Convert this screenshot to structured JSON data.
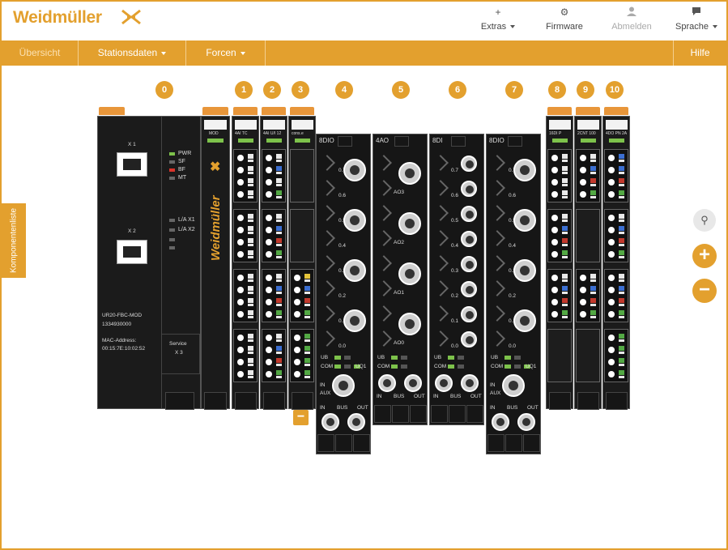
{
  "brand": {
    "name": "Weidmüller"
  },
  "toolbar": {
    "extras": "Extras",
    "firmware": "Firmware",
    "logout": "Abmelden",
    "language": "Sprache"
  },
  "nav": {
    "overview": "Übersicht",
    "station_data": "Stationsdaten",
    "force": "Forcen",
    "help": "Hilfe"
  },
  "side_tab": "Komponentenliste",
  "slots": [
    "0",
    "1",
    "2",
    "3",
    "4",
    "5",
    "6",
    "7",
    "8",
    "9",
    "10"
  ],
  "head": {
    "x1": "X 1",
    "x2": "X 2",
    "leds": [
      "PWR",
      "SF",
      "BF",
      "MT"
    ],
    "link_leds": [
      "L/A X1",
      "L/A X2"
    ],
    "model": "UR20-FBC-MOD",
    "order": "1334930000",
    "mac_label": "MAC-Address:",
    "mac": "00:15:7E:10:02:52",
    "service": "Service",
    "service_port": "X 3",
    "watermark": "Weidmüller",
    "first_module_label": "MOD"
  },
  "modules": {
    "m1": "4AI TC",
    "m2": "4AI U/I 12",
    "m3": "cons.e",
    "m4": "8DIO",
    "m5": "4AO",
    "m6": "8DI",
    "m7": "8DIO",
    "m8": "16DI P",
    "m9": "2CNT 100",
    "m10": "4DO PN 2A"
  },
  "io_labels": {
    "dio8": [
      "0.7",
      "0.6",
      "0.5",
      "0.4",
      "0.3",
      "0.2",
      "0.1",
      "0.0"
    ],
    "ao4": [
      "AO3",
      "AO2",
      "AO1",
      "AO0"
    ],
    "ub": "UB",
    "com": "COM",
    "uq1": "UQ1",
    "in": "IN",
    "aux": "AUX",
    "bus": "BUS",
    "out": "OUT"
  },
  "colors": {
    "accent": "#e3a02e",
    "module": "#1b1b1b",
    "led_green": "#7dc24b",
    "led_red": "#d9342b"
  },
  "icons": [
    "plus-icon",
    "gear-icon",
    "user-icon",
    "chat-icon",
    "search-icon",
    "zoom-in-icon",
    "zoom-out-icon"
  ]
}
